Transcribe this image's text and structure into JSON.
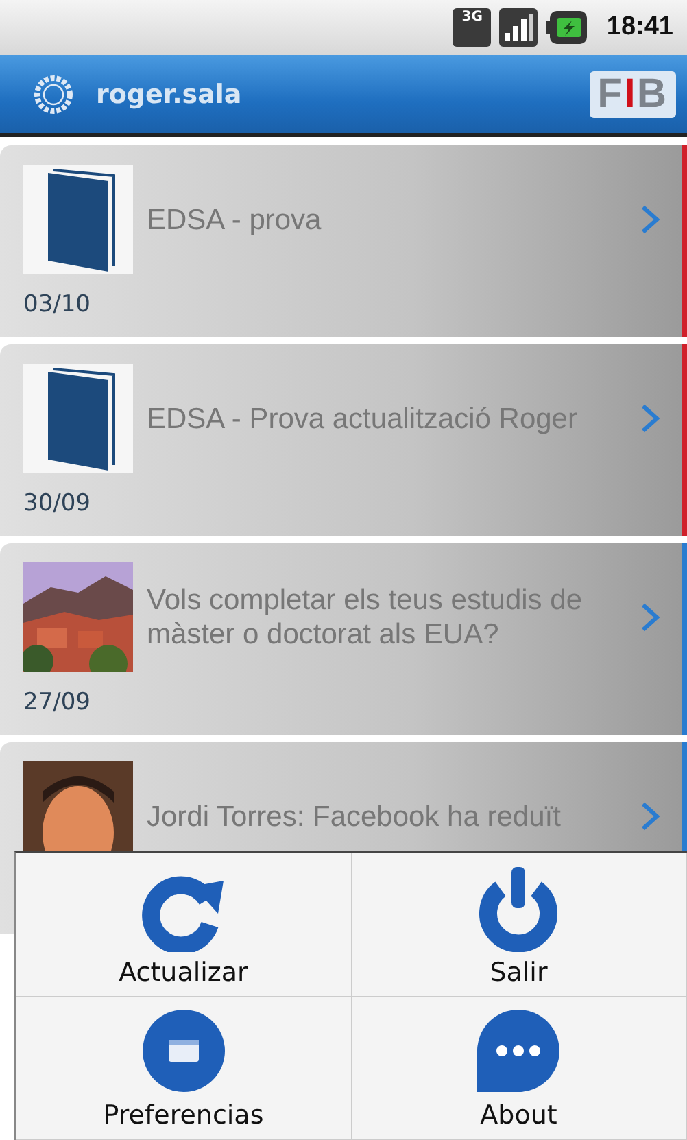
{
  "status_bar": {
    "network_type": "3G",
    "time": "18:41"
  },
  "title_bar": {
    "username": "roger.sala",
    "logo": [
      {
        "text": "F",
        "color": "#7d838b"
      },
      {
        "text": "I",
        "color": "#d0101a"
      },
      {
        "text": "B",
        "color": "#7d838b"
      }
    ]
  },
  "items": [
    {
      "kind": "document",
      "title": "EDSA - prova",
      "date": "03/10",
      "color": "#d0202a"
    },
    {
      "kind": "document",
      "title": "EDSA - Prova actualització Roger",
      "date": "30/09",
      "color": "#d0202a"
    },
    {
      "kind": "picture",
      "title": "Vols completar els teus estudis de màster o doctorat als EUA?",
      "date": "27/09",
      "color": "#2a7cd0"
    },
    {
      "kind": "picture",
      "title": "Jordi Torres: Facebook ha reduït",
      "color": "#2a7cd0"
    }
  ],
  "menu": [
    {
      "kind": "refresh",
      "label": "Actualizar"
    },
    {
      "kind": "power",
      "label": "Salir"
    },
    {
      "kind": "preferences",
      "label": "Preferencias"
    },
    {
      "kind": "about",
      "label": "About"
    }
  ]
}
